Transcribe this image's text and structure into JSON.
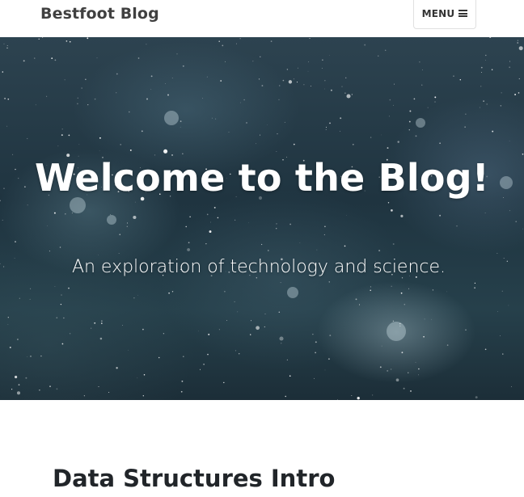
{
  "navbar": {
    "brand": "Bestfoot Blog",
    "menu_label": "MENU",
    "menu_icon": "hamburger-icon"
  },
  "hero": {
    "title": "Welcome to the Blog!",
    "subtitle": "An exploration of technology and science.",
    "background_description_colors": {
      "deep": "#1f3440",
      "mid": "#2d4350",
      "highlight": "#bed7e1"
    }
  },
  "posts": [
    {
      "title": "Data Structures Intro"
    }
  ],
  "colors": {
    "brand_text": "#404040",
    "menu_border": "#e0e0e0",
    "hero_text": "#ffffff",
    "post_title": "#212529",
    "page_background": "#ffffff"
  }
}
